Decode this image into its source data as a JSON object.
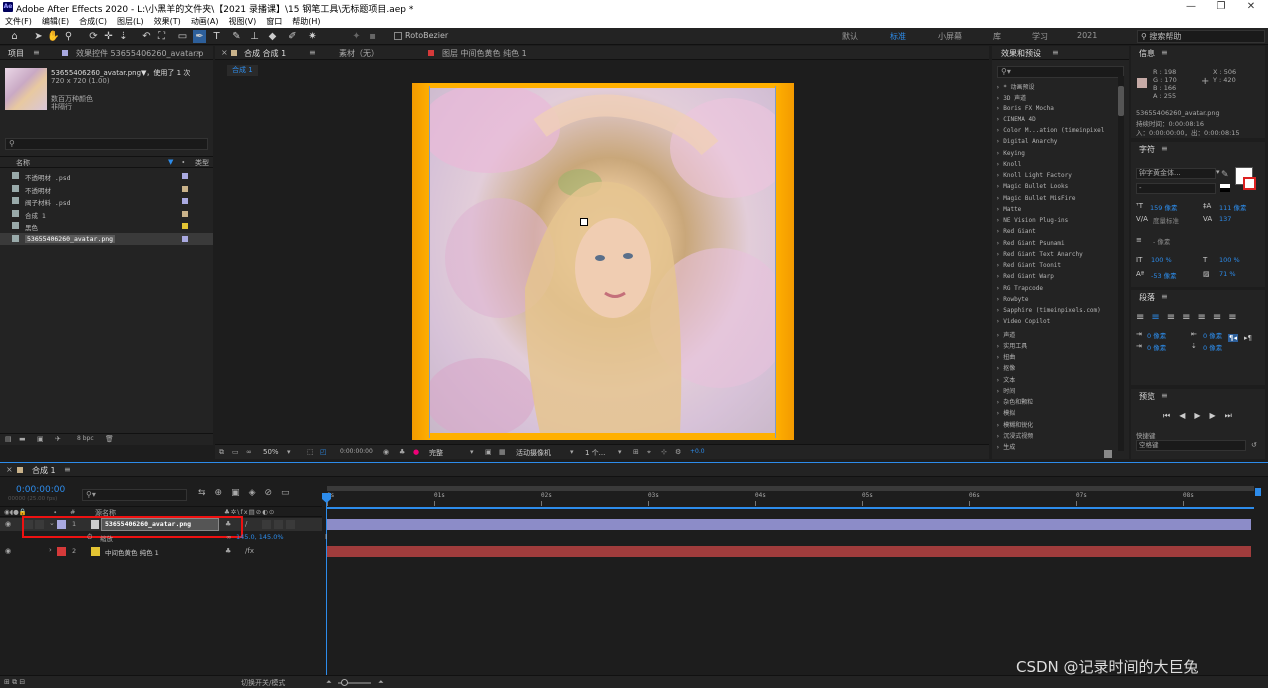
{
  "app": {
    "title": "Adobe After Effects 2020 - L:\\小黑羊的文件夹\\【2021 录播课】\\15 钢笔工具\\无标题项目.aep *",
    "logo": "Ae"
  },
  "menu": [
    "文件(F)",
    "编辑(E)",
    "合成(C)",
    "图层(L)",
    "效果(T)",
    "动画(A)",
    "视图(V)",
    "窗口",
    "帮助(H)"
  ],
  "toolbar": {
    "rotobezier": "RotoBezier",
    "workspaces": [
      "默认",
      "标准",
      "小屏幕",
      "库",
      "学习",
      "2021"
    ],
    "active_workspace": "标准",
    "search_help": "搜索帮助"
  },
  "project": {
    "tab": "项目",
    "fx_tab": "效果控件 53655406260_avatar.p",
    "thumb_name": "53655406260_avatar.png▼，使用了 1 次",
    "thumb_size": "720 x 720 (1.00)",
    "thumb_colors": "数百万种颜色",
    "thumb_interlace": "非隔行",
    "col_name": "名称",
    "col_type": "类型",
    "items": [
      {
        "name": "不透明材 .psd",
        "color": "#a9a9e0"
      },
      {
        "name": "不透明材",
        "color": "#c9b28a"
      },
      {
        "name": "阀子材料 .psd",
        "color": "#a9a9e0"
      },
      {
        "name": "合成 1",
        "color": "#c9b28a"
      },
      {
        "name": "黑色",
        "color": "#e3c433"
      },
      {
        "name": "53655406260_avatar.png",
        "color": "#a9a9e0"
      }
    ],
    "bpc": "8 bpc"
  },
  "composition": {
    "tab": "合成 合成 1",
    "material_tab": "素材（无）",
    "layer_tab": "图层 中间色黄色 纯色 1",
    "breadcrumb": "合成 1",
    "zoom": "50%",
    "timecode": "0:00:00:00",
    "quality": "完整",
    "camera": "活动摄像机",
    "views": "1 个...",
    "exposure": "+0.0"
  },
  "effects": {
    "title": "效果和预设",
    "items": [
      "* 动画预设",
      "3D 声道",
      "Boris FX Mocha",
      "CINEMA 4D",
      "Color M...ation (timeinpixel",
      "Digital Anarchy",
      "Keying",
      "Knoll",
      "Knoll Light Factory",
      "Magic Bullet Looks",
      "Magic Bullet MisFire",
      "Matte",
      "NE Vision Plug-ins",
      "Red Giant",
      "Red Giant Psunami",
      "Red Giant Text Anarchy",
      "Red Giant Toonit",
      "Red Giant Warp",
      "RG Trapcode",
      "Rowbyte",
      "Sapphire (timeinpixels.com)",
      "Video Copilot",
      "声道",
      "实用工具",
      "扭曲",
      "抠像",
      "文本",
      "时间",
      "杂色和颗粒",
      "模拟",
      "模糊和锐化",
      "沉浸式视频",
      "生成"
    ]
  },
  "info": {
    "tab": "信息",
    "r": "R : 198",
    "g": "G : 170",
    "b": "B : 166",
    "a": "A : 255",
    "x": "X : 506",
    "y": "Y : 420",
    "file": "53655406260_avatar.png",
    "dur": "持续时间：0:00:08:16",
    "inout": "入：0:00:00:00，出：0:00:08:15",
    "swatch": "#c6aaa6"
  },
  "character": {
    "tab": "字符",
    "font": "钟字黄金体...",
    "style": "-",
    "size": "159 像素",
    "leading": "111 像素",
    "kerning": "度量标准",
    "tracking": "137",
    "stroke": "- 像素",
    "vscale": "100 %",
    "hscale": "100 %",
    "baseline": "-53 像素",
    "tsume": "71 %"
  },
  "paragraph": {
    "tab": "段落",
    "indent1": "0 像素",
    "indent2": "0 像素",
    "indent3": "0 像素",
    "space1": "0 像素",
    "space2": "0 像素"
  },
  "preview": {
    "tab": "预览",
    "shortcut_label": "快捷键",
    "shortcut": "空格键"
  },
  "timeline": {
    "tab": "合成 1",
    "timecode": "0:00:00:00",
    "fps": "00000 (25.00 fps)",
    "col_name": "源名称",
    "ruler": [
      "0s",
      "01s",
      "02s",
      "03s",
      "04s",
      "05s",
      "06s",
      "07s",
      "08s"
    ],
    "layers": [
      {
        "num": "1",
        "name": "53655406260_avatar.png",
        "color": "#a9a9e0",
        "bar": "#8c8cc8"
      },
      {
        "num": "2",
        "name": "中间色黄色 纯色 1",
        "color": "#e3c433",
        "bar": "#a03c3c"
      }
    ],
    "sub_label": "缩放",
    "sub_value": "145.0, 145.0%",
    "toggle": "切换开关/模式"
  },
  "watermark": "CSDN @记录时间的大巨兔"
}
